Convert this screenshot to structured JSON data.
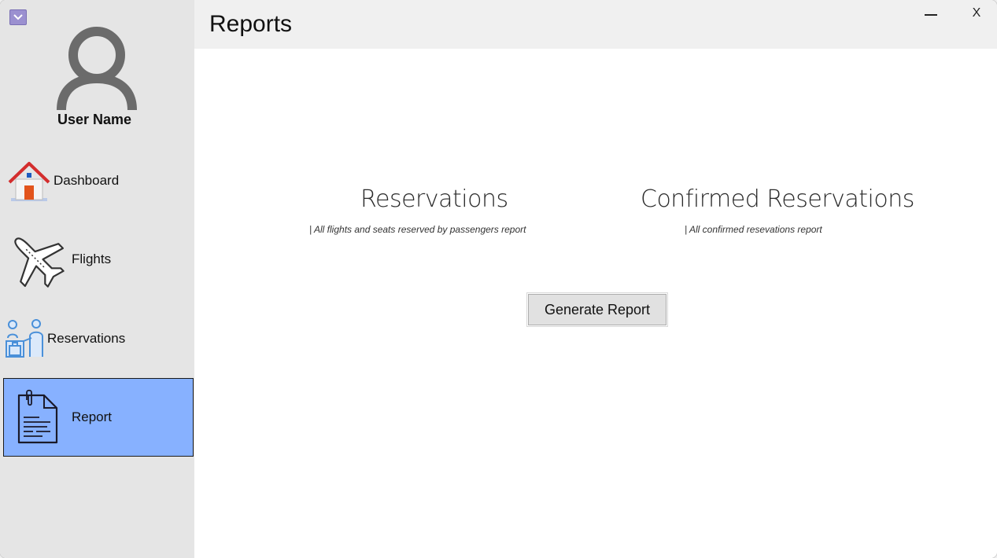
{
  "window": {
    "title": "Reports",
    "minimize_label": "",
    "close_label": "X"
  },
  "sidebar": {
    "user_name": "User Name",
    "items": [
      {
        "label": "Dashboard",
        "icon": "house-icon",
        "active": false
      },
      {
        "label": "Flights",
        "icon": "airplane-icon",
        "active": false
      },
      {
        "label": "Reservations",
        "icon": "reservation-desk-icon",
        "active": false
      },
      {
        "label": "Report",
        "icon": "document-icon",
        "active": true
      }
    ]
  },
  "main": {
    "reports": [
      {
        "title": "Reservations",
        "description": "| All flights and seats reserved by passengers report"
      },
      {
        "title": "Confirmed Reservations",
        "description": "| All confirmed resevations report"
      }
    ],
    "generate_button_label": "Generate Report"
  },
  "colors": {
    "sidebar_bg": "#e5e5e5",
    "active_item_bg": "#87b1ff",
    "titlebar_bg": "#f0f0f0",
    "content_bg": "#ffffff"
  }
}
